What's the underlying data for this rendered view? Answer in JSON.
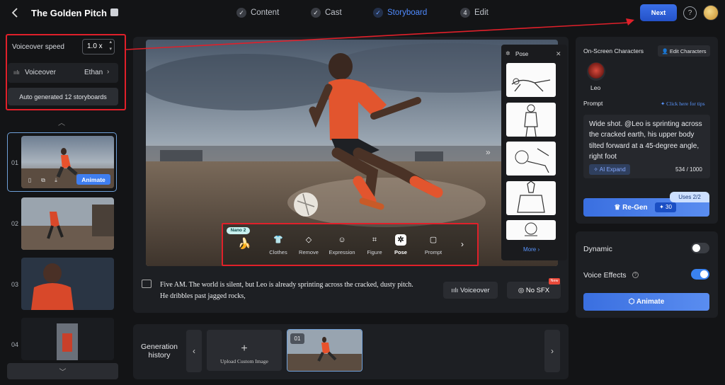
{
  "header": {
    "title": "The Golden Pitch",
    "steps": [
      {
        "label": "Content",
        "marker": "✓"
      },
      {
        "label": "Cast",
        "marker": "✓"
      },
      {
        "label": "Storyboard",
        "marker": "✓"
      },
      {
        "label": "Edit",
        "marker": "4"
      }
    ],
    "next_label": "Next",
    "help_label": "?"
  },
  "left": {
    "speed_label": "Voiceover speed",
    "speed_value": "1.0 x",
    "voiceover_label": "Voiceover",
    "voiceover_value": "Ethan",
    "auto_generated": "Auto generated 12 storyboards",
    "storyboards": [
      {
        "num": "01"
      },
      {
        "num": "02"
      },
      {
        "num": "03"
      },
      {
        "num": "04"
      }
    ],
    "animate_label": "Animate"
  },
  "editor": {
    "nano_badge": "Nano 2",
    "tools": [
      {
        "label": "Clothes",
        "icon": "👕"
      },
      {
        "label": "Remove",
        "icon": "◇"
      },
      {
        "label": "Expression",
        "icon": "☺"
      },
      {
        "label": "Figure",
        "icon": "⌗"
      },
      {
        "label": "Pose",
        "icon": "✲"
      },
      {
        "label": "Prompt",
        "icon": "▢"
      }
    ],
    "pose": {
      "title": "Pose",
      "more_label": "More"
    },
    "caption_line1": "Five AM. The world is silent, but Leo is already sprinting across the cracked, dusty pitch.",
    "caption_line2": "He dribbles past jagged rocks,",
    "voiceover_btn": "Voiceover",
    "sfx_btn": "No SFX",
    "new_badge": "New"
  },
  "history": {
    "label": "Generation history",
    "upload_label": "Upload Custom Image",
    "thumb_num": "01"
  },
  "right": {
    "onscreen_label": "On-Screen Characters",
    "edit_chars": "Edit Characters",
    "character_name": "Leo",
    "prompt_label": "Prompt",
    "tips": "Click here for tips",
    "prompt_text": "Wide shot. @Leo is sprinting across the cracked earth, his upper body tilted forward at a 45-degree angle, right foot",
    "ai_expand": "AI Expand",
    "char_count": "534 / 1000",
    "uses": "Uses  2/2",
    "regen": "Re-Gen",
    "credits": "30",
    "dynamic_label": "Dynamic",
    "dynamic_on": false,
    "voice_effects_label": "Voice Effects",
    "voice_effects_on": true,
    "animate_btn": "Animate"
  },
  "colors": {
    "accent": "#3a6fe8",
    "highlight_red": "#e0202a",
    "active_step": "#4f8bff"
  }
}
